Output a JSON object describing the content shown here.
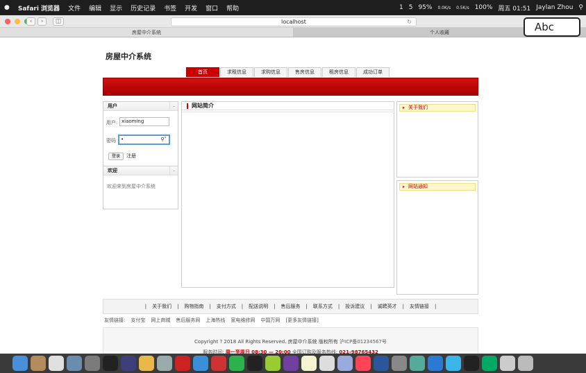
{
  "menubar": {
    "apple": "",
    "app": "Safari 浏览器",
    "items": [
      "文件",
      "编辑",
      "显示",
      "历史记录",
      "书签",
      "开发",
      "窗口",
      "帮助"
    ],
    "status": {
      "notif1": "1",
      "notif2": "5",
      "battery": "95%",
      "net_up": "0.0K/s",
      "net_down": "0.5K/s",
      "battery2": "100%",
      "date": "周五 01:51",
      "user": "Jaylan Zhou"
    }
  },
  "browser": {
    "url": "localhost",
    "tabs": [
      "房屋中介系统",
      "个人收藏"
    ],
    "ime": "Abc"
  },
  "site": {
    "title": "房屋中介系统",
    "nav": [
      "首页",
      "求租信息",
      "求购信息",
      "售房信息",
      "租房信息",
      "成功订单"
    ],
    "login": {
      "header": "用户",
      "user_label": "用户:",
      "user_value": "xiaoming",
      "pass_label": "密码",
      "pass_value": "•",
      "login_btn": "登录",
      "register": "注册"
    },
    "welcome": {
      "header": "欢迎",
      "text": "欢迎来到房屋中介系统"
    },
    "center": {
      "header": "网站简介"
    },
    "right": {
      "about": "关于我们",
      "notice": "网站通知"
    },
    "footer_links": [
      "关于我们",
      "购物指南",
      "支付方式",
      "配送说明",
      "售后服务",
      "联系方式",
      "投诉建议",
      "诚聘英才",
      "友情链接"
    ],
    "friends": {
      "label": "友情链接:",
      "items": [
        "支付宝",
        "网上商城",
        "售后服务网",
        "上海热线",
        "家电维修网",
        "中国万网",
        "[更多友情链接]"
      ]
    },
    "copyright": "Copyright ? 2018 All Rights Reserved. 房屋中介系统 版权所有",
    "icp": "沪ICP备01234567号",
    "service_label": "服务时间:",
    "service_time": "周一至周日 08:30 — 20:00",
    "hotline_label": "全国订购及服务热线:",
    "hotline": "021-98765432"
  },
  "colors": {
    "brand": "#cc0000",
    "menubar": "#1e1e1e"
  }
}
